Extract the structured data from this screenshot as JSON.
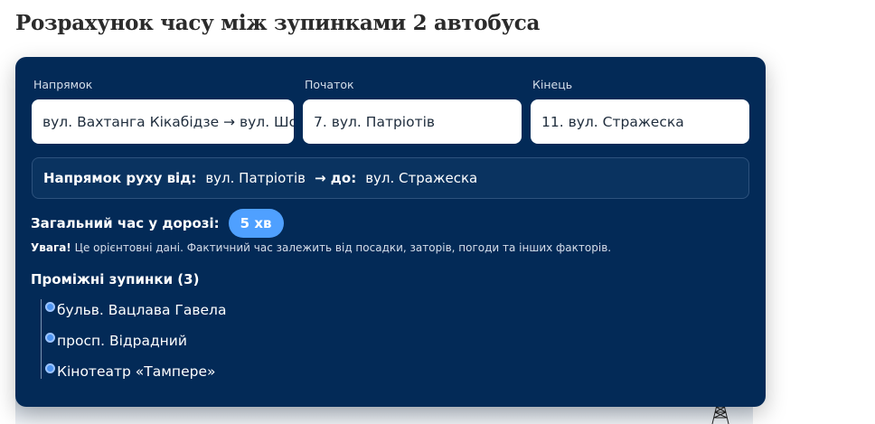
{
  "page": {
    "title": "Розрахунок часу між зупинками 2 автобуса"
  },
  "form": {
    "direction": {
      "label": "Напрямок",
      "value": "вул. Вахтанга Кікабідзе → вул. Шо"
    },
    "start": {
      "label": "Початок",
      "value": "7. вул. Патріотів"
    },
    "end": {
      "label": "Кінець",
      "value": "11. вул. Стражеска"
    }
  },
  "direction_info": {
    "from_label": "Напрямок руху від:",
    "from_value": "вул. Патріотів",
    "to_label": "→ до:",
    "to_value": "вул. Стражеска"
  },
  "total": {
    "label": "Загальний час у дорозі:",
    "value": "5 хв"
  },
  "warning": {
    "bold": "Увага!",
    "text": "Це орієнтовні дані. Фактичний час залежить від посадки, заторів, погоди та інших факторів."
  },
  "stops": {
    "heading": "Проміжні зупинки (3)",
    "items": [
      "бульв. Вацлава Гавела",
      "просп. Відрадний",
      "Кінотеатр «Тампере»"
    ]
  },
  "colors": {
    "panel_bg": "#032a57",
    "accent": "#4fa0ff"
  }
}
